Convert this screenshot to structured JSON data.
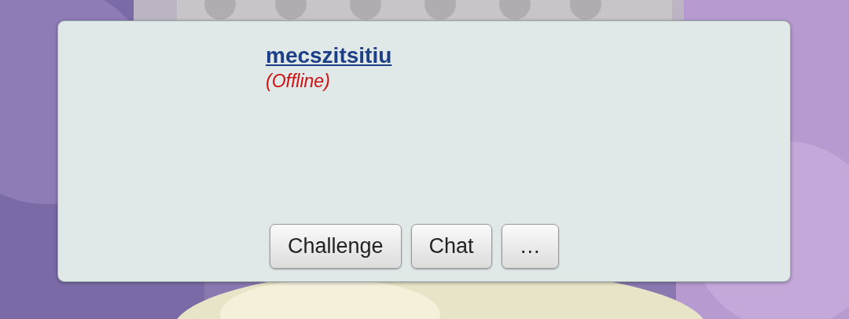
{
  "user": {
    "name": "mecszitsitiu",
    "status": "(Offline)"
  },
  "buttons": [
    "Challenge",
    "Chat",
    "…"
  ]
}
